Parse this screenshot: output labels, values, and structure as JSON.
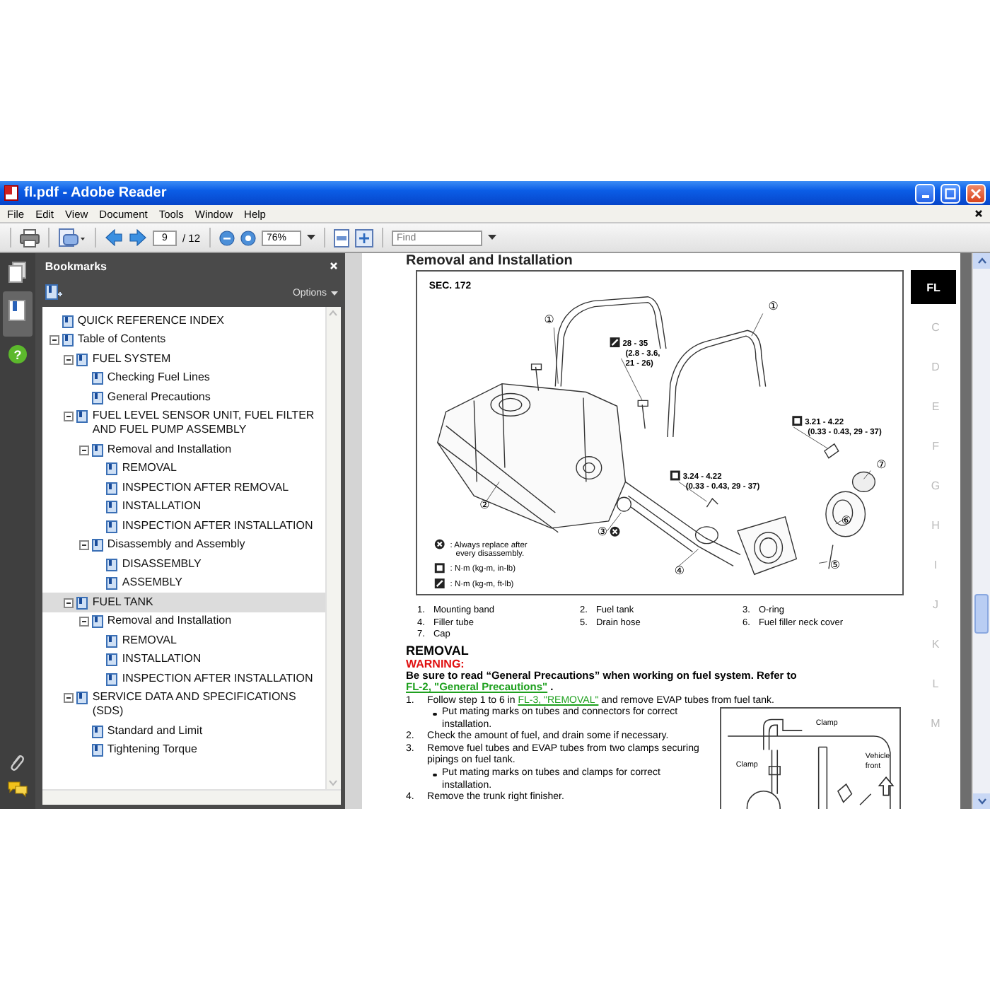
{
  "window": {
    "title": "fl.pdf - Adobe Reader"
  },
  "menu": [
    "File",
    "Edit",
    "View",
    "Document",
    "Tools",
    "Window",
    "Help"
  ],
  "toolbar": {
    "page": "9",
    "page_count": "/ 12",
    "zoom": "76%",
    "find_placeholder": "Find"
  },
  "left_rail": {
    "help_glyph": "?"
  },
  "bookmarks": {
    "title": "Bookmarks",
    "options": "Options",
    "items": [
      {
        "label": "QUICK REFERENCE INDEX",
        "selected": false
      },
      {
        "label": "Table of Contents",
        "selected": false,
        "expanded": true,
        "children": [
          {
            "label": "FUEL SYSTEM",
            "selected": false,
            "expanded": true,
            "children": [
              {
                "label": "Checking Fuel Lines",
                "selected": false
              },
              {
                "label": "General Precautions",
                "selected": false
              }
            ]
          },
          {
            "label": "FUEL LEVEL SENSOR UNIT, FUEL FILTER AND FUEL PUMP ASSEMBLY",
            "selected": false,
            "expanded": true,
            "children": [
              {
                "label": "Removal and Installation",
                "selected": false,
                "expanded": true,
                "children": [
                  {
                    "label": "REMOVAL",
                    "selected": false
                  },
                  {
                    "label": "INSPECTION AFTER REMOVAL",
                    "selected": false
                  },
                  {
                    "label": "INSTALLATION",
                    "selected": false
                  },
                  {
                    "label": "INSPECTION AFTER INSTALLATION",
                    "selected": false
                  }
                ]
              },
              {
                "label": "Disassembly and Assembly",
                "selected": false,
                "expanded": true,
                "children": [
                  {
                    "label": "DISASSEMBLY",
                    "selected": false
                  },
                  {
                    "label": "ASSEMBLY",
                    "selected": false
                  }
                ]
              }
            ]
          },
          {
            "label": "FUEL TANK",
            "selected": true,
            "expanded": true,
            "children": [
              {
                "label": "Removal and Installation",
                "selected": false,
                "expanded": true,
                "children": [
                  {
                    "label": "REMOVAL",
                    "selected": false
                  },
                  {
                    "label": "INSTALLATION",
                    "selected": false
                  },
                  {
                    "label": "INSPECTION AFTER INSTALLATION",
                    "selected": false
                  }
                ]
              }
            ]
          },
          {
            "label": "SERVICE DATA AND SPECIFICATIONS (SDS)",
            "selected": false,
            "expanded": true,
            "children": [
              {
                "label": "Standard and Limit",
                "selected": false
              },
              {
                "label": "Tightening Torque",
                "selected": false
              }
            ]
          }
        ]
      }
    ]
  },
  "page": {
    "heading": "Removal and Installation",
    "figure": {
      "section": "SEC. 172",
      "callouts": [
        "①",
        "①",
        "②",
        "③",
        "④",
        "⑤",
        "⑥",
        "⑦"
      ],
      "specs": [
        {
          "kind": "ft-lb",
          "lines": [
            "28 - 35",
            "(2.8 - 3.6,",
            "21 - 26)"
          ]
        },
        {
          "kind": "in-lb",
          "lines": [
            "3.21 - 4.22",
            "(0.33 - 0.43, 29 - 37)"
          ]
        },
        {
          "kind": "in-lb",
          "lines": [
            "3.24 - 4.22",
            "(0.33 - 0.43, 29 - 37)"
          ]
        }
      ],
      "legend": [
        {
          "kind": "replace",
          "lines": [
            ": Always replace after",
            "every disassembly."
          ]
        },
        {
          "kind": "in-lb",
          "lines": [
            ": N·m (kg-m, in-lb)"
          ]
        },
        {
          "kind": "ft-lb",
          "lines": [
            ": N·m (kg-m, ft-lb)"
          ]
        }
      ]
    },
    "parts": [
      {
        "number": "1.",
        "name": "Mounting band"
      },
      {
        "number": "2.",
        "name": "Fuel tank"
      },
      {
        "number": "3.",
        "name": "O-ring"
      },
      {
        "number": "4.",
        "name": "Filler tube"
      },
      {
        "number": "5.",
        "name": "Drain hose"
      },
      {
        "number": "6.",
        "name": "Fuel filler neck cover"
      },
      {
        "number": "7.",
        "name": "Cap"
      }
    ],
    "removal": {
      "title": "REMOVAL",
      "warning_label": "WARNING:",
      "warning_text": "Be sure to read “General Precautions” when working on fuel system. Refer to",
      "warning_link": "FL-2, \"General Precautions\"",
      "warning_end": ".",
      "steps": [
        {
          "kind": "step",
          "number": "1.",
          "text": "Follow step 1 to 6 in",
          "link": "FL-3, \"REMOVAL\"",
          "text_after": "and remove EVAP tubes from fuel tank."
        },
        {
          "kind": "bullet",
          "text": "Put mating marks on tubes and connectors for correct installation."
        },
        {
          "kind": "step",
          "number": "2.",
          "text": "Check the amount of fuel, and drain some if necessary."
        },
        {
          "kind": "step",
          "number": "3.",
          "text": "Remove fuel tubes and EVAP tubes from two clamps securing pipings on fuel tank."
        },
        {
          "kind": "bullet",
          "text": "Put mating marks on tubes and clamps for correct installation."
        },
        {
          "kind": "step",
          "number": "4.",
          "text": "Remove the trunk right finisher."
        }
      ],
      "figure": {
        "clamp_labels": [
          "Clamp",
          "Clamp"
        ],
        "direction_lines": [
          "Vehicle",
          "front"
        ]
      }
    }
  },
  "side_tabs": [
    {
      "label": "FL",
      "selected": true
    },
    {
      "label": "C",
      "selected": false
    },
    {
      "label": "D",
      "selected": false
    },
    {
      "label": "E",
      "selected": false
    },
    {
      "label": "F",
      "selected": false
    },
    {
      "label": "G",
      "selected": false
    },
    {
      "label": "H",
      "selected": false
    },
    {
      "label": "I",
      "selected": false
    },
    {
      "label": "J",
      "selected": false
    },
    {
      "label": "K",
      "selected": false
    },
    {
      "label": "L",
      "selected": false
    },
    {
      "label": "M",
      "selected": false
    }
  ]
}
